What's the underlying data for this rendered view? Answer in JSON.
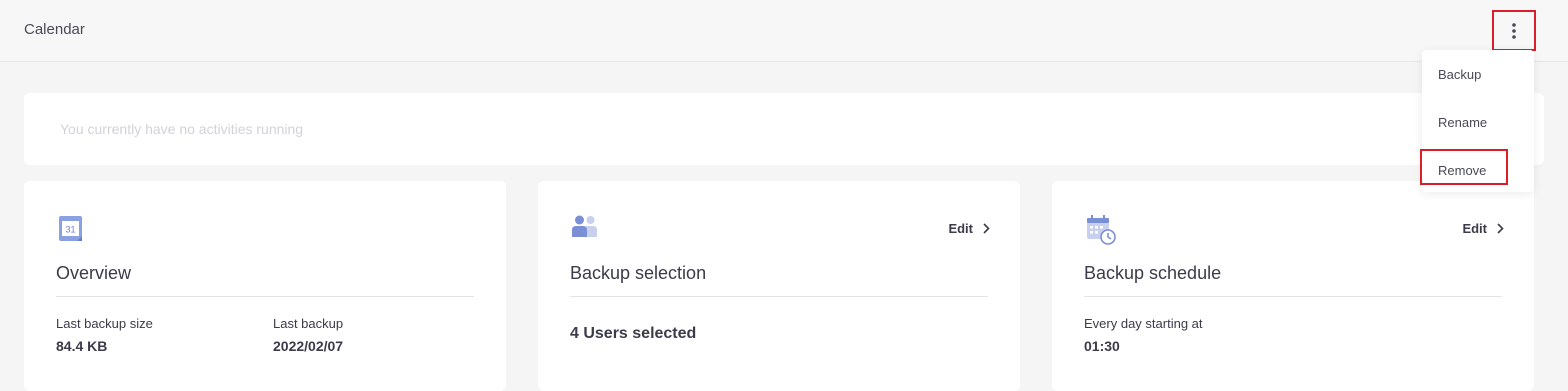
{
  "header": {
    "title": "Calendar"
  },
  "activity": {
    "message": "You currently have no activities running"
  },
  "menu": {
    "items": [
      {
        "label": "Backup"
      },
      {
        "label": "Rename"
      },
      {
        "label": "Remove"
      }
    ]
  },
  "cards": {
    "overview": {
      "title": "Overview",
      "icon": "calendar-31-icon",
      "last_size_label": "Last backup size",
      "last_size_value": "84.4 KB",
      "last_backup_label": "Last backup",
      "last_backup_value": "2022/02/07"
    },
    "selection": {
      "title": "Backup selection",
      "icon": "users-icon",
      "edit_label": "Edit",
      "summary": "4 Users selected"
    },
    "schedule": {
      "title": "Backup schedule",
      "icon": "calendar-clock-icon",
      "edit_label": "Edit",
      "frequency_label": "Every day starting at",
      "time_value": "01:30"
    }
  },
  "colors": {
    "accent": "#7b8fd6",
    "highlight": "#d81f2a"
  }
}
